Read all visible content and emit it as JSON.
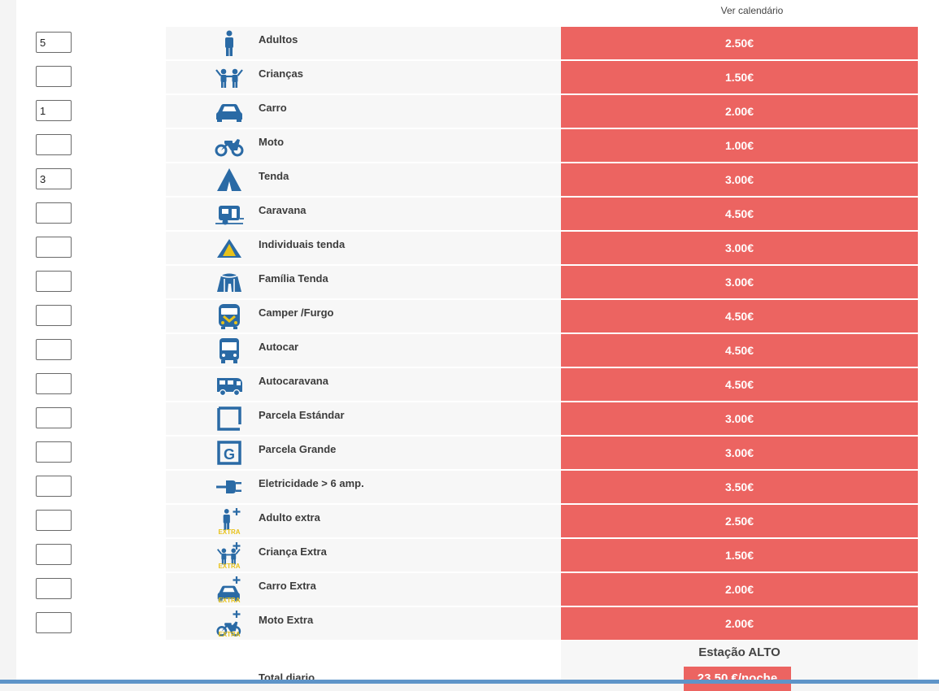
{
  "calendar_link": "Ver calendário",
  "rows": [
    {
      "qty": "5",
      "icon": "adult-icon",
      "label": "Adultos",
      "price": "2.50€"
    },
    {
      "qty": "",
      "icon": "children-icon",
      "label": "Crianças",
      "price": "1.50€"
    },
    {
      "qty": "1",
      "icon": "car-icon",
      "label": "Carro",
      "price": "2.00€"
    },
    {
      "qty": "",
      "icon": "motorcycle-icon",
      "label": "Moto",
      "price": "1.00€"
    },
    {
      "qty": "3",
      "icon": "tent-icon",
      "label": "Tenda",
      "price": "3.00€"
    },
    {
      "qty": "",
      "icon": "caravan-icon",
      "label": "Caravana",
      "price": "4.50€"
    },
    {
      "qty": "",
      "icon": "individual-tent-icon",
      "label": "Individuais tenda",
      "price": "3.00€"
    },
    {
      "qty": "",
      "icon": "family-tent-icon",
      "label": "Família Tenda",
      "price": "3.00€"
    },
    {
      "qty": "",
      "icon": "camper-van-icon",
      "label": "Camper /Furgo",
      "price": "4.50€"
    },
    {
      "qty": "",
      "icon": "bus-icon",
      "label": "Autocar",
      "price": "4.50€"
    },
    {
      "qty": "",
      "icon": "motorhome-icon",
      "label": "Autocaravana",
      "price": "4.50€"
    },
    {
      "qty": "",
      "icon": "standard-plot-icon",
      "label": "Parcela Estándar",
      "price": "3.00€"
    },
    {
      "qty": "",
      "icon": "large-plot-icon",
      "label": "Parcela Grande",
      "price": "3.00€"
    },
    {
      "qty": "",
      "icon": "electric-plug-icon",
      "label": "Eletricidade > 6 amp.",
      "price": "3.50€"
    },
    {
      "qty": "",
      "icon": "extra-adult-icon",
      "label": "Adulto extra",
      "price": "2.50€"
    },
    {
      "qty": "",
      "icon": "extra-child-icon",
      "label": "Criança Extra",
      "price": "1.50€"
    },
    {
      "qty": "",
      "icon": "extra-car-icon",
      "label": "Carro Extra",
      "price": "2.00€"
    },
    {
      "qty": "",
      "icon": "extra-motorcycle-icon",
      "label": "Moto Extra",
      "price": "2.00€"
    }
  ],
  "extra_badge": "EXTRA",
  "plot_large_letter": "G",
  "season": "Estação ALTO",
  "total_label": "Total diario",
  "total_value": "23.50 €/noche",
  "colors": {
    "price_bg": "#ec6461",
    "icon_blue": "#2a6aa5",
    "extra_yellow": "#e8c21a",
    "bottom_bar": "#5e94c8"
  }
}
